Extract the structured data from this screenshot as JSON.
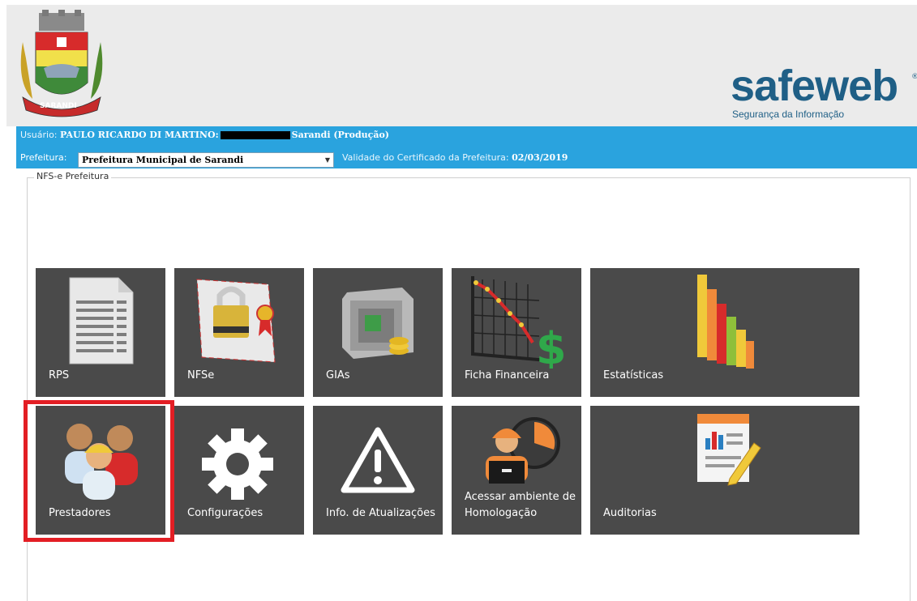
{
  "header": {
    "crest_text": "SARANDI",
    "brand": "safeweb",
    "brand_tagline": "Segurança da Informação",
    "brand_reg": "®"
  },
  "infobar": {
    "user_label": "Usuário:",
    "user_name": "PAULO RICARDO DI MARTINO:",
    "env": "Sarandi (Produção)",
    "prefeitura_label": "Prefeitura:",
    "prefeitura_selected": "Prefeitura Municipal de Sarandi",
    "validade_label": "Validade do Certificado da Prefeitura:",
    "validade_value": "02/03/2019"
  },
  "group": {
    "legend": "NFS-e Prefeitura"
  },
  "tiles": [
    {
      "label": "RPS"
    },
    {
      "label": "NFSe"
    },
    {
      "label": "GIAs"
    },
    {
      "label": "Ficha Financeira"
    },
    {
      "label": "Estatísticas"
    },
    {
      "label": "Prestadores"
    },
    {
      "label": "Configurações"
    },
    {
      "label": "Info. de Atualizações"
    },
    {
      "label": "Acessar ambiente de Homologação"
    },
    {
      "label": "Auditorias"
    }
  ],
  "colors": {
    "infobar": "#2aa3de",
    "tile": "#4a4a4a",
    "highlight": "#e31e24",
    "brand": "#1f5f86"
  }
}
